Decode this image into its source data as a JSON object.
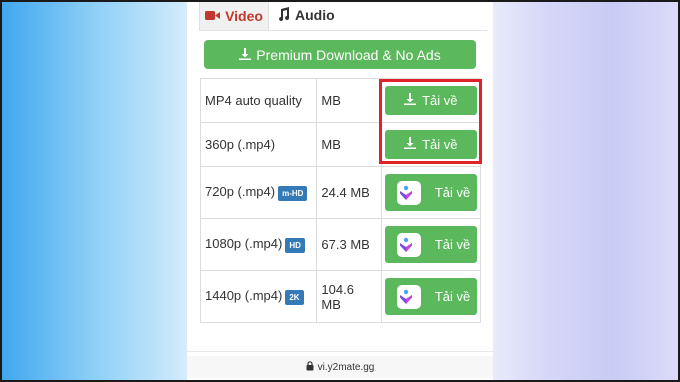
{
  "tabs": [
    {
      "label": "Video",
      "icon": "video-camera-icon",
      "active": true,
      "color": "#c0392b"
    },
    {
      "label": "Audio",
      "icon": "music-note-icon",
      "active": false
    }
  ],
  "premium_button": {
    "label": "Premium Download & No Ads",
    "icon": "download-icon",
    "color": "#5cb85c"
  },
  "rows": [
    {
      "quality": "MP4 auto quality",
      "badge": "",
      "size": "MB",
      "button": "Tải về",
      "button_icon": "download-icon"
    },
    {
      "quality": "360p (.mp4)",
      "badge": "",
      "size": "MB",
      "button": "Tải về",
      "button_icon": "download-icon"
    },
    {
      "quality": "720p (.mp4)",
      "badge": "m-HD",
      "size": "24.4 MB",
      "button": "Tải về",
      "button_icon": "app-logo-icon"
    },
    {
      "quality": "1080p (.mp4)",
      "badge": "HD",
      "size": "67.3 MB",
      "button": "Tải về",
      "button_icon": "app-logo-icon"
    },
    {
      "quality": "1440p (.mp4)",
      "badge": "2K",
      "size": "104.6 MB",
      "button": "Tải về",
      "button_icon": "app-logo-icon"
    }
  ],
  "url_bar": {
    "text": "vi.y2mate.gg",
    "icon": "lock-icon"
  },
  "colors": {
    "highlight": "#e0232b",
    "badge": "#337ab7"
  }
}
